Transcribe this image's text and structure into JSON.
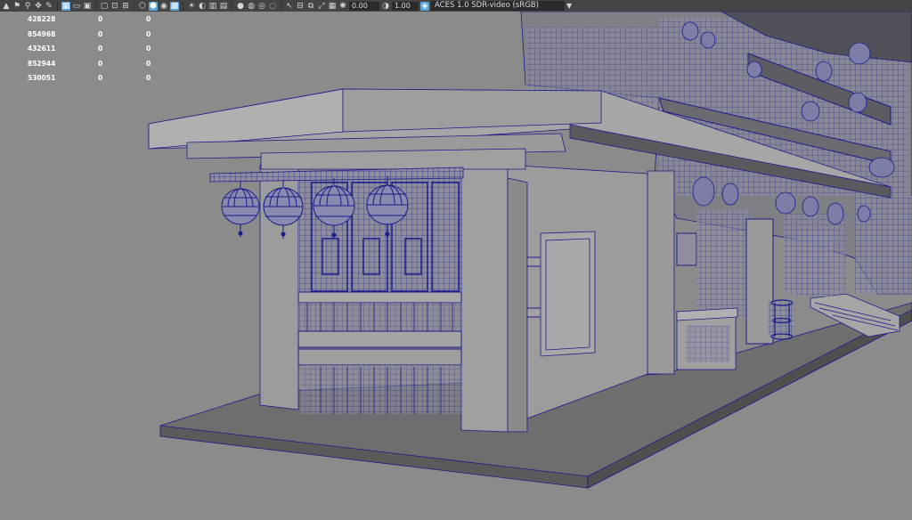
{
  "toolbar": {
    "icons": [
      "bookmark-icon",
      "flag-icon",
      "camera-icon",
      "move-camera-icon",
      "paint-icon",
      "grid-icon",
      "film-gate-icon",
      "resolution-gate-icon",
      "safe-frame-icon",
      "wireframe-cube-icon",
      "shaded-cube-icon",
      "textured-icon",
      "lights-icon",
      "sun-icon",
      "shadows-icon",
      "isolate-icon",
      "ambient-occlusion-icon",
      "motion-blur-icon",
      "antialias-icon",
      "xray-icon",
      "pointer-icon",
      "snapshot-icon",
      "fullscreen-icon",
      "settings-icon",
      "exposure-icon"
    ],
    "exposure_value": "0.00",
    "gamma_value": "1.00",
    "color_space": "ACES 1.0 SDR-video (sRGB)"
  },
  "stats": {
    "rows": [
      {
        "a": "428228",
        "b": "0",
        "c": "0"
      },
      {
        "a": "854968",
        "b": "0",
        "c": "0"
      },
      {
        "a": "432611",
        "b": "0",
        "c": "0"
      },
      {
        "a": "852944",
        "b": "0",
        "c": "0"
      },
      {
        "a": "530051",
        "b": "0",
        "c": "0"
      }
    ]
  },
  "colors": {
    "background": "#8b8b8b",
    "wire": "#1c1c8a",
    "surface": "#9a9a9a",
    "toolbar": "#444444"
  }
}
